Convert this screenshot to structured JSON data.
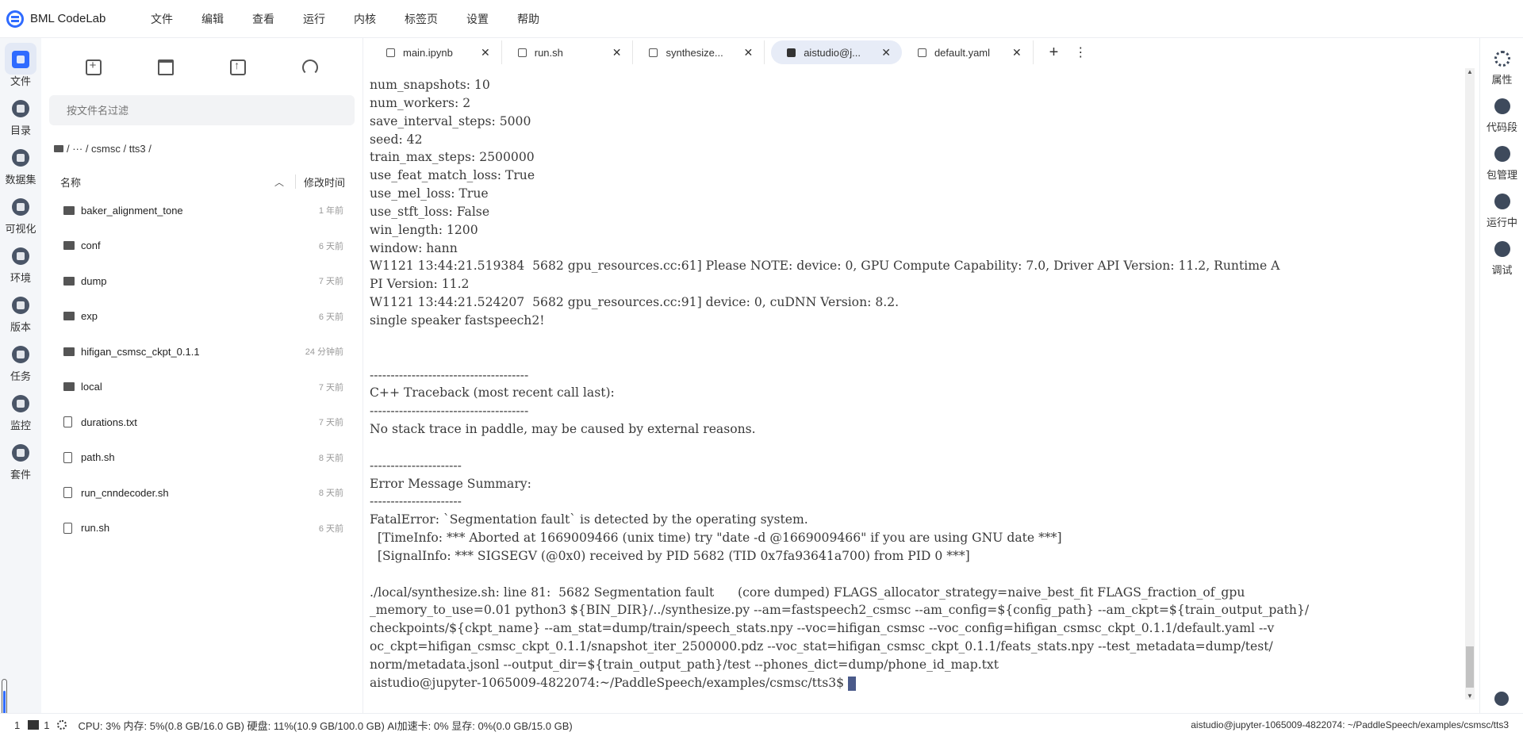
{
  "app": {
    "title": "BML CodeLab"
  },
  "menu": [
    "文件",
    "编辑",
    "查看",
    "运行",
    "内核",
    "标签页",
    "设置",
    "帮助"
  ],
  "activity_bar": [
    {
      "label": "文件",
      "icon": "folder-icon",
      "active": true
    },
    {
      "label": "目录",
      "icon": "list-icon"
    },
    {
      "label": "数据集",
      "icon": "dataset-icon"
    },
    {
      "label": "可视化",
      "icon": "chart-icon"
    },
    {
      "label": "环境",
      "icon": "environment-icon"
    },
    {
      "label": "版本",
      "icon": "version-icon"
    },
    {
      "label": "任务",
      "icon": "task-icon"
    },
    {
      "label": "监控",
      "icon": "monitor-icon"
    },
    {
      "label": "套件",
      "icon": "suite-icon"
    }
  ],
  "file_panel": {
    "search_placeholder": "按文件名过滤",
    "breadcrumb": "/  ···  / csmsc / tts3 /",
    "col_name": "名称",
    "col_time": "修改时间",
    "files": [
      {
        "name": "baker_alignment_tone",
        "type": "folder",
        "time": "1 年前"
      },
      {
        "name": "conf",
        "type": "folder",
        "time": "6 天前"
      },
      {
        "name": "dump",
        "type": "folder",
        "time": "7 天前"
      },
      {
        "name": "exp",
        "type": "folder",
        "time": "6 天前"
      },
      {
        "name": "hifigan_csmsc_ckpt_0.1.1",
        "type": "folder",
        "time": "24 分钟前"
      },
      {
        "name": "local",
        "type": "folder",
        "time": "7 天前"
      },
      {
        "name": "durations.txt",
        "type": "file",
        "time": "7 天前"
      },
      {
        "name": "path.sh",
        "type": "file",
        "time": "8 天前"
      },
      {
        "name": "run_cnndecoder.sh",
        "type": "file",
        "time": "8 天前"
      },
      {
        "name": "run.sh",
        "type": "file",
        "time": "6 天前"
      }
    ]
  },
  "tabs": [
    {
      "label": "main.ipynb",
      "active": false
    },
    {
      "label": "run.sh",
      "active": false
    },
    {
      "label": "synthesize...",
      "active": false
    },
    {
      "label": "aistudio@j...",
      "active": true
    },
    {
      "label": "default.yaml",
      "active": false
    }
  ],
  "terminal": {
    "lines": [
      "num_snapshots: 10",
      "num_workers: 2",
      "save_interval_steps: 5000",
      "seed: 42",
      "train_max_steps: 2500000",
      "use_feat_match_loss: True",
      "use_mel_loss: True",
      "use_stft_loss: False",
      "win_length: 1200",
      "window: hann",
      "W1121 13:44:21.519384  5682 gpu_resources.cc:61] Please NOTE: device: 0, GPU Compute Capability: 7.0, Driver API Version: 11.2, Runtime A",
      "PI Version: 11.2",
      "W1121 13:44:21.524207  5682 gpu_resources.cc:91] device: 0, cuDNN Version: 8.2.",
      "single speaker fastspeech2!",
      "",
      "",
      "--------------------------------------",
      "C++ Traceback (most recent call last):",
      "--------------------------------------",
      "No stack trace in paddle, may be caused by external reasons.",
      "",
      "----------------------",
      "Error Message Summary:",
      "----------------------",
      "FatalError: `Segmentation fault` is detected by the operating system.",
      "  [TimeInfo: *** Aborted at 1669009466 (unix time) try \"date -d @1669009466\" if you are using GNU date ***]",
      "  [SignalInfo: *** SIGSEGV (@0x0) received by PID 5682 (TID 0x7fa93641a700) from PID 0 ***]",
      "",
      "./local/synthesize.sh: line 81:  5682 Segmentation fault      (core dumped) FLAGS_allocator_strategy=naive_best_fit FLAGS_fraction_of_gpu",
      "_memory_to_use=0.01 python3 ${BIN_DIR}/../synthesize.py --am=fastspeech2_csmsc --am_config=${config_path} --am_ckpt=${train_output_path}/",
      "checkpoints/${ckpt_name} --am_stat=dump/train/speech_stats.npy --voc=hifigan_csmsc --voc_config=hifigan_csmsc_ckpt_0.1.1/default.yaml --v",
      "oc_ckpt=hifigan_csmsc_ckpt_0.1.1/snapshot_iter_2500000.pdz --voc_stat=hifigan_csmsc_ckpt_0.1.1/feats_stats.npy --test_metadata=dump/test/",
      "norm/metadata.jsonl --output_dir=${train_output_path}/test --phones_dict=dump/phone_id_map.txt"
    ],
    "prompt": "aistudio@jupyter-1065009-4822074:~/PaddleSpeech/examples/csmsc/tts3$ "
  },
  "right_bar": [
    {
      "label": "属性",
      "icon": "gear-icon"
    },
    {
      "label": "代码段",
      "icon": "code-icon"
    },
    {
      "label": "包管理",
      "icon": "package-icon"
    },
    {
      "label": "运行中",
      "icon": "play-icon"
    },
    {
      "label": "调试",
      "icon": "bug-icon"
    }
  ],
  "status_bar": {
    "count1": "1",
    "count2": "1",
    "resources": "CPU:  3% 内存:  5%(0.8 GB/16.0 GB) 硬盘:  11%(10.9 GB/100.0 GB)  AI加速卡:  0%   显存:  0%(0.0 GB/15.0 GB)",
    "path": "aistudio@jupyter-1065009-4822074: ~/PaddleSpeech/examples/csmsc/tts3"
  }
}
